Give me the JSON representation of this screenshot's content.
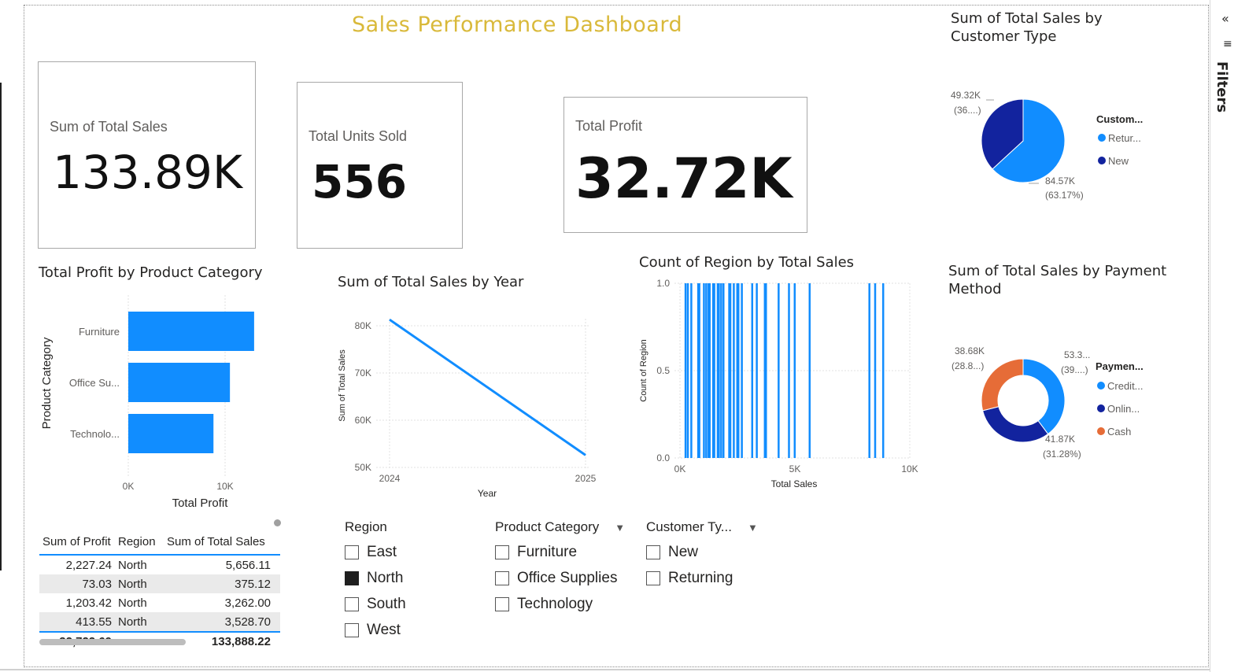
{
  "title": "Sales Performance Dashboard",
  "cards": {
    "total_sales": {
      "label": "Sum of Total Sales",
      "value": "133.89K"
    },
    "units_sold": {
      "label": "Total Units Sold",
      "value": "556"
    },
    "total_profit": {
      "label": "Total Profit",
      "value": "32.72K"
    }
  },
  "bar_chart": {
    "title": "Total Profit by Product Category",
    "ylabel": "Product Category",
    "xlabel": "Total Profit",
    "ticks": [
      "0K",
      "10K"
    ]
  },
  "line_chart": {
    "title": "Sum of Total Sales by Year",
    "ylabel": "Sum of Total Sales",
    "xlabel": "Year",
    "yticks": [
      "80K",
      "70K",
      "60K",
      "50K"
    ],
    "xticks": [
      "2024",
      "2025"
    ]
  },
  "col_chart": {
    "title": "Count of Region by Total Sales",
    "ylabel": "Count of Region",
    "xlabel": "Total Sales",
    "yticks": [
      "1.0",
      "0.5",
      "0.0"
    ],
    "xticks": [
      "0K",
      "5K",
      "10K"
    ]
  },
  "pie_chart": {
    "title": "Sum of Total Sales by Customer Type",
    "legend_title": "Custom...",
    "legend": [
      "Retur...",
      "New"
    ],
    "labels": [
      {
        "value": "49.32K",
        "pct": "(36....)"
      },
      {
        "value": "84.57K",
        "pct": "(63.17%)"
      }
    ]
  },
  "donut_chart": {
    "title": "Sum of Total Sales by Payment Method",
    "legend_title": "Paymen...",
    "legend": [
      "Credit...",
      "Onlin...",
      "Cash"
    ],
    "labels": [
      {
        "value": "38.68K",
        "pct": "(28.8...)"
      },
      {
        "value": "53.3...",
        "pct": "(39....)"
      },
      {
        "value": "41.87K",
        "pct": "(31.28%)"
      }
    ]
  },
  "table": {
    "headers": [
      "Sum of Profit",
      "Region",
      "Sum of Total Sales"
    ],
    "rows": [
      [
        "2,227.24",
        "North",
        "5,656.11"
      ],
      [
        "73.03",
        "North",
        "375.12"
      ],
      [
        "1,203.42",
        "North",
        "3,262.00"
      ],
      [
        "413.55",
        "North",
        "3,528.70"
      ]
    ],
    "total": [
      "32,722.69",
      "",
      "133,888.22"
    ]
  },
  "slicers": {
    "region": {
      "title": "Region",
      "items": [
        {
          "label": "East",
          "checked": false
        },
        {
          "label": "North",
          "checked": true
        },
        {
          "label": "South",
          "checked": false
        },
        {
          "label": "West",
          "checked": false
        }
      ]
    },
    "category": {
      "title": "Product Category",
      "items": [
        {
          "label": "Furniture",
          "checked": false
        },
        {
          "label": "Office Supplies",
          "checked": false
        },
        {
          "label": "Technology",
          "checked": false
        }
      ]
    },
    "customer": {
      "title": "Customer Ty...",
      "items": [
        {
          "label": "New",
          "checked": false
        },
        {
          "label": "Returning",
          "checked": false
        }
      ]
    }
  },
  "filters_pane": {
    "label": "Filters",
    "collapse_glyph": "«",
    "icon": "filter-icon"
  },
  "colors": {
    "primary": "#118dff",
    "dark": "#12239e",
    "orange": "#e66c37",
    "title": "#d9b93a"
  },
  "chart_data": [
    {
      "type": "bar",
      "title": "Total Profit by Product Category",
      "categories": [
        "Furniture",
        "Office Su...",
        "Technolo..."
      ],
      "values": [
        13000,
        10500,
        8800
      ],
      "xlabel": "Total Profit",
      "ylabel": "Product Category",
      "xlim": [
        0,
        13000
      ]
    },
    {
      "type": "line",
      "title": "Sum of Total Sales by Year",
      "x": [
        "2024",
        "2025"
      ],
      "values": [
        81300,
        52600
      ],
      "xlabel": "Year",
      "ylabel": "Sum of Total Sales",
      "ylim": [
        50000,
        83000
      ]
    },
    {
      "type": "bar",
      "title": "Count of Region by Total Sales",
      "x": [
        200,
        300,
        450,
        750,
        800,
        1000,
        1100,
        1200,
        1250,
        1400,
        1450,
        1600,
        1650,
        1750,
        1850,
        2100,
        2150,
        2300,
        2450,
        2500,
        2650,
        3100,
        3300,
        3650,
        3700,
        4250,
        4700,
        4950,
        5600,
        8200,
        8450,
        8800
      ],
      "values": [
        1,
        1,
        1,
        1,
        1,
        1,
        1,
        1,
        1,
        1,
        1,
        1,
        1,
        1,
        1,
        1,
        1,
        1,
        1,
        1,
        1,
        1,
        1,
        1,
        1,
        1,
        1,
        1,
        1,
        1,
        1,
        1
      ],
      "xlabel": "Total Sales",
      "ylabel": "Count of Region",
      "xlim": [
        0,
        10000
      ],
      "ylim": [
        0,
        1
      ]
    },
    {
      "type": "pie",
      "title": "Sum of Total Sales by Customer Type",
      "categories": [
        "Retur...",
        "New"
      ],
      "values": [
        84570,
        49320
      ]
    },
    {
      "type": "pie",
      "title": "Sum of Total Sales by Payment Method",
      "categories": [
        "Credit...",
        "Onlin...",
        "Cash"
      ],
      "values": [
        53300,
        41870,
        38680
      ]
    }
  ]
}
